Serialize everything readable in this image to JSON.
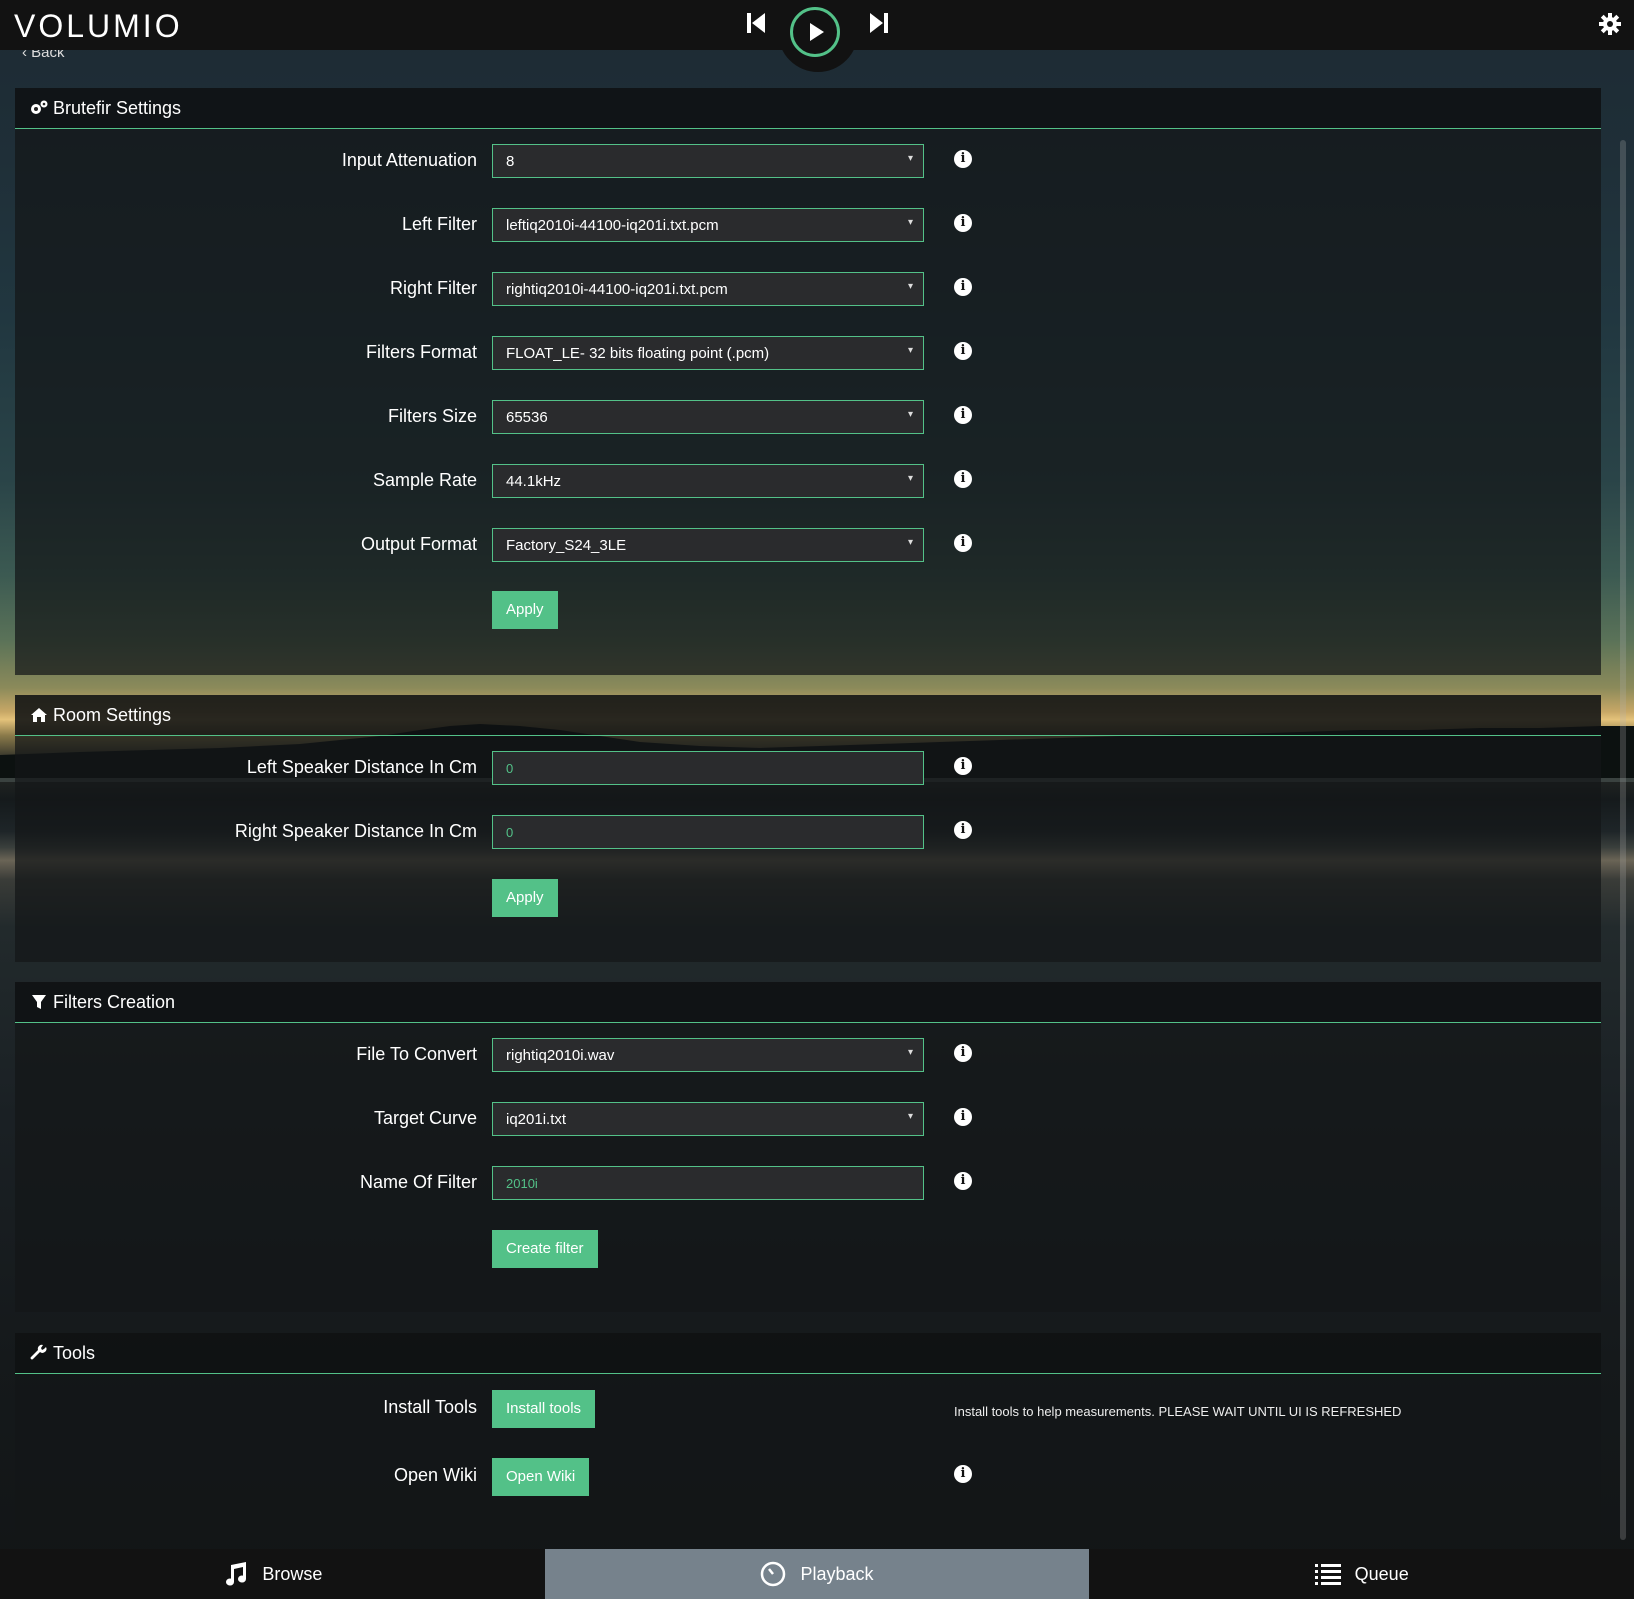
{
  "app": {
    "logo": "VOLUMIO"
  },
  "nav": {
    "back_label": "Back"
  },
  "sections": {
    "brutefir": {
      "title": "Brutefir Settings",
      "rows": [
        {
          "label": "Input Attenuation",
          "value": "8"
        },
        {
          "label": "Left Filter",
          "value": "leftiq2010i-44100-iq201i.txt.pcm"
        },
        {
          "label": "Right Filter",
          "value": "rightiq2010i-44100-iq201i.txt.pcm"
        },
        {
          "label": "Filters Format",
          "value": "FLOAT_LE- 32 bits floating point (.pcm)"
        },
        {
          "label": "Filters Size",
          "value": "65536"
        },
        {
          "label": "Sample Rate",
          "value": "44.1kHz"
        },
        {
          "label": "Output Format",
          "value": "Factory_S24_3LE"
        }
      ],
      "apply_label": "Apply"
    },
    "room": {
      "title": "Room Settings",
      "rows": [
        {
          "label": "Left Speaker Distance In Cm",
          "value": "0"
        },
        {
          "label": "Right Speaker Distance In Cm",
          "value": "0"
        }
      ],
      "apply_label": "Apply"
    },
    "filters": {
      "title": "Filters Creation",
      "rows": [
        {
          "label": "File To Convert",
          "value": "rightiq2010i.wav"
        },
        {
          "label": "Target Curve",
          "value": "iq201i.txt"
        },
        {
          "label": "Name Of Filter",
          "value": "2010i"
        }
      ],
      "create_label": "Create filter"
    },
    "tools": {
      "title": "Tools",
      "install_label": "Install Tools",
      "install_button": "Install tools",
      "install_note": "Install tools to help measurements. PLEASE WAIT UNTIL UI IS REFRESHED",
      "wiki_label": "Open Wiki",
      "wiki_button": "Open Wiki"
    }
  },
  "bottom_tabs": {
    "browse": "Browse",
    "playback": "Playback",
    "queue": "Queue"
  },
  "colors": {
    "accent": "#53c188",
    "bar": "#121212",
    "active_tab": "#76828c"
  }
}
